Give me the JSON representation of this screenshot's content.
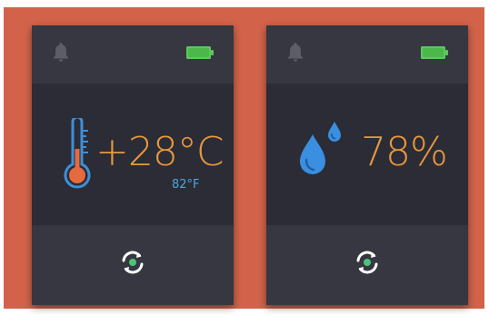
{
  "colors": {
    "background": "#d2634a",
    "device": "#2e2f38",
    "value_text": "#e8973e",
    "sub_text": "#4aa7dd",
    "battery": "#5dc85d",
    "icon_muted": "#5c5d66",
    "refresh": "#4bc47a"
  },
  "temperature_card": {
    "icons": {
      "status": "bell-icon",
      "battery": "battery-icon",
      "main": "thermometer-icon",
      "action": "refresh-icon"
    },
    "value": "+28°C",
    "secondary_value": "82°F"
  },
  "humidity_card": {
    "icons": {
      "status": "bell-icon",
      "battery": "battery-icon",
      "main": "water-drops-icon",
      "action": "refresh-icon"
    },
    "value": "78%"
  }
}
